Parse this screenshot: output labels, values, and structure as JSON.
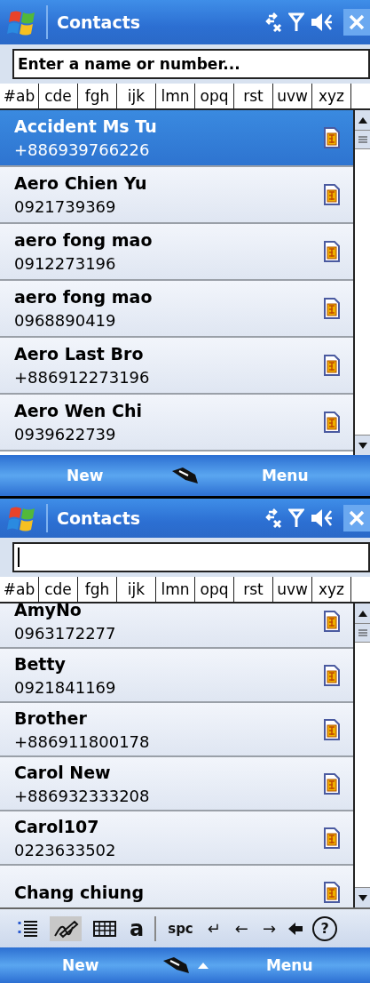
{
  "screens": [
    {
      "title": "Contacts",
      "search": {
        "placeholder": "Enter a name or number...",
        "focused": false
      },
      "letter_tabs": [
        "#ab",
        "cde",
        "fgh",
        "ijk",
        "lmn",
        "opq",
        "rst",
        "uvw",
        "xyz"
      ],
      "contacts": [
        {
          "name": "Accident Ms Tu",
          "number": "+886939766226",
          "selected": true
        },
        {
          "name": "Aero Chien Yu",
          "number": "0921739369",
          "selected": false
        },
        {
          "name": "aero fong mao",
          "number": "0912273196",
          "selected": false
        },
        {
          "name": "aero fong mao",
          "number": "0968890419",
          "selected": false
        },
        {
          "name": "Aero Last Bro",
          "number": "+886912273196",
          "selected": false
        },
        {
          "name": "Aero Wen Chi",
          "number": "0939622739",
          "selected": false
        }
      ],
      "softkeys": {
        "left": "New",
        "right": "Menu",
        "input_panel_open": false
      }
    },
    {
      "title": "Contacts",
      "search": {
        "focused": true
      },
      "letter_tabs": [
        "#ab",
        "cde",
        "fgh",
        "ijk",
        "lmn",
        "opq",
        "rst",
        "uvw",
        "xyz"
      ],
      "contacts": [
        {
          "name": "AmyNo",
          "number": "0963172277",
          "selected": false
        },
        {
          "name": "Betty",
          "number": "0921841169",
          "selected": false
        },
        {
          "name": "Brother",
          "number": "+886911800178",
          "selected": false
        },
        {
          "name": "Carol New",
          "number": "+886932333208",
          "selected": false
        },
        {
          "name": "Carol107",
          "number": "0223633502",
          "selected": false
        },
        {
          "name": "Chang chiung",
          "selected": false
        }
      ],
      "input_panel": {
        "modes": [
          {
            "kind": "menu",
            "selected": false
          },
          {
            "kind": "transcriber",
            "selected": true
          },
          {
            "kind": "keyboard",
            "selected": false
          },
          {
            "kind": "letter",
            "label": "a",
            "selected": false
          }
        ],
        "keys": [
          "spc",
          "↵",
          "←",
          "→"
        ],
        "help": "?"
      },
      "softkeys": {
        "left": "New",
        "right": "Menu",
        "input_panel_open": true
      }
    }
  ]
}
